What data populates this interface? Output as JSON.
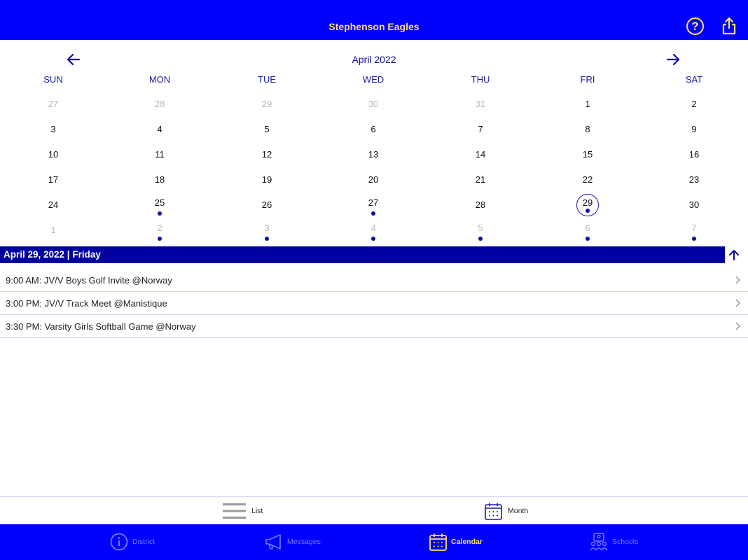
{
  "header": {
    "title": "Stephenson Eagles",
    "help_icon": "question-circle-icon",
    "share_icon": "share-icon",
    "accent_color": "#ffe066",
    "bar_color": "#0000ff"
  },
  "calendar": {
    "month_title": "April 2022",
    "weekdays": [
      "SUN",
      "MON",
      "TUE",
      "WED",
      "THU",
      "FRI",
      "SAT"
    ],
    "weeks": [
      [
        {
          "n": "27",
          "muted": true
        },
        {
          "n": "28",
          "muted": true
        },
        {
          "n": "29",
          "muted": true
        },
        {
          "n": "30",
          "muted": true
        },
        {
          "n": "31",
          "muted": true
        },
        {
          "n": "1"
        },
        {
          "n": "2"
        }
      ],
      [
        {
          "n": "3"
        },
        {
          "n": "4"
        },
        {
          "n": "5"
        },
        {
          "n": "6"
        },
        {
          "n": "7"
        },
        {
          "n": "8"
        },
        {
          "n": "9"
        }
      ],
      [
        {
          "n": "10"
        },
        {
          "n": "11"
        },
        {
          "n": "12"
        },
        {
          "n": "13"
        },
        {
          "n": "14"
        },
        {
          "n": "15"
        },
        {
          "n": "16"
        }
      ],
      [
        {
          "n": "17"
        },
        {
          "n": "18"
        },
        {
          "n": "19"
        },
        {
          "n": "20"
        },
        {
          "n": "21"
        },
        {
          "n": "22"
        },
        {
          "n": "23"
        }
      ],
      [
        {
          "n": "24"
        },
        {
          "n": "25",
          "event": true
        },
        {
          "n": "26"
        },
        {
          "n": "27",
          "event": true
        },
        {
          "n": "28"
        },
        {
          "n": "29",
          "event": true,
          "selected": true
        },
        {
          "n": "30"
        }
      ],
      [
        {
          "n": "1",
          "muted": true
        },
        {
          "n": "2",
          "muted": true,
          "event": true
        },
        {
          "n": "3",
          "muted": true,
          "event": true
        },
        {
          "n": "4",
          "muted": true,
          "event": true
        },
        {
          "n": "5",
          "muted": true,
          "event": true
        },
        {
          "n": "6",
          "muted": true,
          "event": true
        },
        {
          "n": "7",
          "muted": true,
          "event": true
        }
      ]
    ]
  },
  "selected_day": {
    "header": "April 29, 2022 | Friday",
    "events": [
      "9:00 AM: JV/V Boys Golf Invite @Norway",
      "3:00 PM: JV/V Track Meet @Manistique",
      "3:30 PM: Varsity Girls Softball Game @Norway"
    ]
  },
  "view_switch": {
    "list_label": "List",
    "month_label": "Month"
  },
  "tabbar": {
    "tabs": [
      {
        "label": "District",
        "icon": "info-circle-icon",
        "active": false
      },
      {
        "label": "Messages",
        "icon": "megaphone-icon",
        "active": false
      },
      {
        "label": "Calendar",
        "icon": "calendar-icon",
        "active": true
      },
      {
        "label": "Schools",
        "icon": "schools-icon",
        "active": false
      }
    ]
  }
}
